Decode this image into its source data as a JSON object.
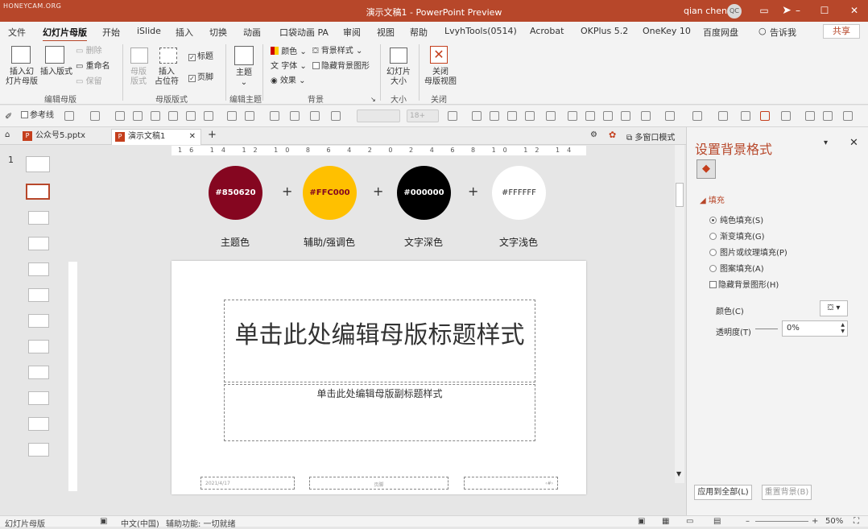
{
  "titlebar": {
    "watermark": "HONEYCAM.ORG",
    "title": "演示文稿1  -  PowerPoint Preview",
    "user": "qian chen",
    "avatar": "QC"
  },
  "menu": {
    "tabs": [
      "文件",
      "幻灯片母版",
      "开始",
      "iSlide",
      "插入",
      "切换",
      "动画",
      "口袋动画 PA",
      "审阅",
      "视图",
      "帮助",
      "LvyhTools(0514)",
      "Acrobat",
      "OKPlus 5.2",
      "OneKey 10",
      "百度网盘"
    ],
    "active": "幻灯片母版",
    "tellme": "告诉我",
    "share": "共享"
  },
  "ribbon": {
    "insert_master": "插入幻\n灯片母版",
    "insert_layout": "插入版式",
    "delete": "删除",
    "rename": "重命名",
    "preserve": "保留",
    "group_edit_master": "编辑母版",
    "master_layout": "母版\n版式",
    "insert_placeholder": "插入\n占位符",
    "title_cb": "标题",
    "footer_cb": "页脚",
    "group_master_layout": "母版版式",
    "themes": "主题",
    "group_edit_theme": "编辑主题",
    "colors": "颜色",
    "fonts": "字体",
    "effects": "效果",
    "bg_styles": "背景样式",
    "hide_bg": "隐藏背景图形",
    "group_background": "背景",
    "slide_size": "幻灯片\n大小",
    "group_size": "大小",
    "close_master": "关闭\n母版视图",
    "group_close": "关闭"
  },
  "format_bar": {
    "reference_line": "参考线",
    "font_size": "18+"
  },
  "docs": {
    "tabs": [
      {
        "name": "公众号5.pptx"
      },
      {
        "name": "演示文稿1"
      }
    ],
    "multi_window": "多窗口模式"
  },
  "thumbs": {
    "slide_number": "1"
  },
  "ruler": {
    "h_labels": "16 14 12 10 8 6 4 2 0 2 4 6 8 10 12 14 16"
  },
  "swatches": [
    {
      "hex": "#850620",
      "label": "主题色",
      "fill": "#850620",
      "text": "#ffffff"
    },
    {
      "hex": "#FFC000",
      "label": "辅助/强调色",
      "fill": "#FFC000",
      "text": "#850620"
    },
    {
      "hex": "#000000",
      "label": "文字深色",
      "fill": "#000000",
      "text": "#ffffff"
    },
    {
      "hex": "#FFFFFF",
      "label": "文字浅色",
      "fill": "#FFFFFF",
      "text": "#333333"
    }
  ],
  "slide": {
    "title": "单击此处编辑母版标题样式",
    "subtitle": "单击此处编辑母版副标题样式",
    "date": "2021/4/17",
    "footer": "页脚",
    "page": "‹#›"
  },
  "pane": {
    "title": "设置背景格式",
    "section": "填充",
    "options": [
      "纯色填充(S)",
      "渐变填充(G)",
      "图片或纹理填充(P)",
      "图案填充(A)"
    ],
    "selected": 0,
    "hide_bg": "隐藏背景图形(H)",
    "color_label": "颜色(C)",
    "transparency_label": "透明度(T)",
    "transparency_value": "0%",
    "apply_all": "应用到全部(L)",
    "reset_bg": "重置背景(B)"
  },
  "status": {
    "view": "幻灯片母版",
    "lang": "中文(中国)",
    "accessibility": "辅助功能: 一切就绪",
    "zoom": "50%"
  },
  "colors": {
    "accent": "#b7472a"
  }
}
